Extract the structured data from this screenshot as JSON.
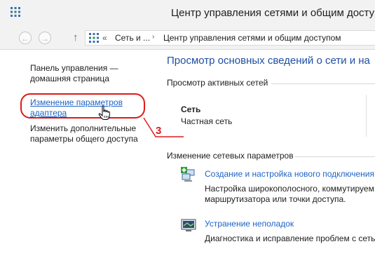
{
  "window": {
    "title": "Центр управления сетями и общим доступ"
  },
  "nav": {
    "back_glyph": "←",
    "forward_glyph": "→",
    "up_glyph": "↑",
    "address": {
      "overflow": "«",
      "crumb1": "Сеть и ...",
      "separator": "›",
      "crumb2": "Центр управления сетями и общим доступом"
    }
  },
  "sidebar": {
    "home_line1": "Панель управления —",
    "home_line2": "домашняя страница",
    "adapter_line1": "Изменение параметров",
    "adapter_line2": "адаптера",
    "sharing_line1": "Изменить дополнительные",
    "sharing_line2": "параметры общего доступа"
  },
  "annotation": {
    "number": "3",
    "color": "#dd1a1a"
  },
  "main": {
    "heading": "Просмотр основных сведений о сети и на",
    "active_networks_label": "Просмотр активных сетей",
    "network": {
      "name": "Сеть",
      "type": "Частная сеть"
    },
    "change_settings_label": "Изменение сетевых параметров",
    "tasks": [
      {
        "icon": "new-connection-icon",
        "title": "Создание и настройка нового подключения",
        "desc_line1": "Настройка широкополосного, коммутируем",
        "desc_line2": "маршрутизатора или точки доступа."
      },
      {
        "icon": "troubleshoot-icon",
        "title": "Устранение неполадок",
        "desc_line1": "Диагностика и исправление проблем с сетью",
        "desc_line2": ""
      }
    ]
  },
  "colors": {
    "link": "#1e63c6",
    "heading": "#1f4fa3",
    "chrome": "#f2f2f2"
  }
}
